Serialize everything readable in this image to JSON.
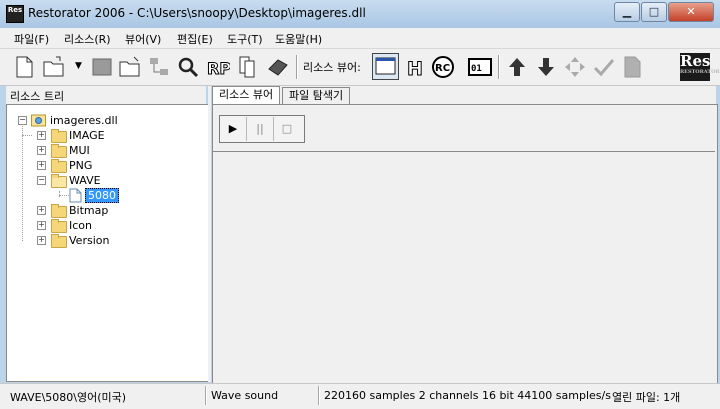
{
  "window": {
    "title": "Restorator 2006 - C:\\Users\\snoopy\\Desktop\\imageres.dll",
    "app_icon_text": "Res"
  },
  "menu": [
    "파일(F)",
    "리소스(R)",
    "뷰어(V)",
    "편집(E)",
    "도구(T)",
    "도움말(H)"
  ],
  "toolbar": {
    "viewer_label": "리소스 뷰어:",
    "logo_text": "Res"
  },
  "left_pane": {
    "title": "리소스 트리"
  },
  "tree": {
    "root": "imageres.dll",
    "folders": [
      "IMAGE",
      "MUI",
      "PNG",
      "WAVE",
      "Bitmap",
      "Icon",
      "Version"
    ],
    "wave_child": "5080"
  },
  "tabs": [
    "리소스 뷰어",
    "파일 탐색기"
  ],
  "player": {
    "play": "▶",
    "pause": "||",
    "stop": "□"
  },
  "status": {
    "path": "WAVE\\5080\\영어(미국)",
    "type": "Wave sound",
    "info": "220160 samples  2 channels  16 bit  44100 samples/s",
    "open_files": "열린 파일: 1개"
  }
}
